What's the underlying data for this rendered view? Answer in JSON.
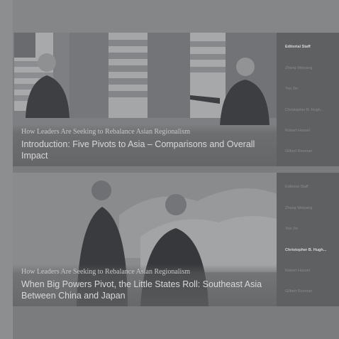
{
  "cards": [
    {
      "kicker": "How Leaders Are Seeking to Rebalance Asian Regionalism",
      "title": "Introduction: Five Pivots to Asia – Comparisons and Overall Impact",
      "authors": [
        "Editorial Staff",
        "Zhang Weiyang",
        "Yoo Jin",
        "Christopher B. Hugh...",
        "Robert Hassel",
        "Gilbert Rozman"
      ],
      "active_index": 0
    },
    {
      "kicker": "How Leaders Are Seeking to Rebalance Asian Regionalism",
      "title": "When Big Powers Pivot, the Little States Roll: Southeast Asia Between China and Japan",
      "authors": [
        "Editorial Staff",
        "Zhang Weiyang",
        "Yoo Jin",
        "Christopher B. Hugh...",
        "Robert Hassel",
        "Gilbert Rozman"
      ],
      "active_index": 3
    }
  ],
  "colors": {
    "background": "#8d8e90",
    "card_overlay": "#5f6062",
    "sidebar": "#5f6062",
    "active_text": "#d9d9d9",
    "inactive_text": "#8a8b8d"
  }
}
